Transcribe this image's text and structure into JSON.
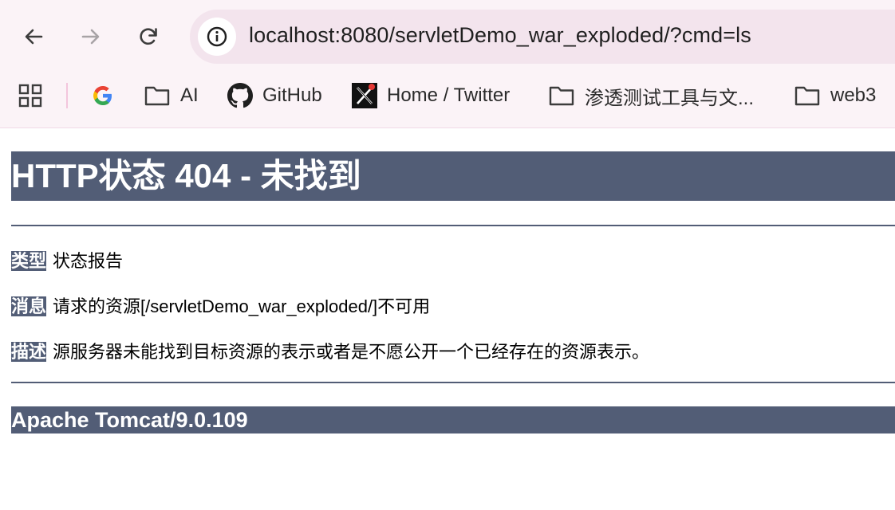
{
  "browser": {
    "url": "localhost:8080/servletDemo_war_exploded/?cmd=ls",
    "bookmarks": [
      {
        "label": "",
        "icon": "google-icon"
      },
      {
        "label": "AI",
        "icon": "folder-icon"
      },
      {
        "label": "GitHub",
        "icon": "github-icon"
      },
      {
        "label": "Home / Twitter",
        "icon": "x-icon"
      },
      {
        "label": "渗透测试工具与文...",
        "icon": "folder-icon"
      },
      {
        "label": "web3",
        "icon": "folder-icon"
      }
    ]
  },
  "page": {
    "title": "HTTP状态 404 - 未找到",
    "type_label": "类型",
    "type_value": "状态报告",
    "message_label": "消息",
    "message_value": "请求的资源[/servletDemo_war_exploded/]不可用",
    "description_label": "描述",
    "description_value": "源服务器未能找到目标资源的表示或者是不愿公开一个已经存在的资源表示。",
    "server": "Apache Tomcat/9.0.109"
  },
  "colors": {
    "header_bg": "#525d76",
    "chrome_bg": "#fbf3f7",
    "omnibox_bg": "#f3e4ed"
  }
}
